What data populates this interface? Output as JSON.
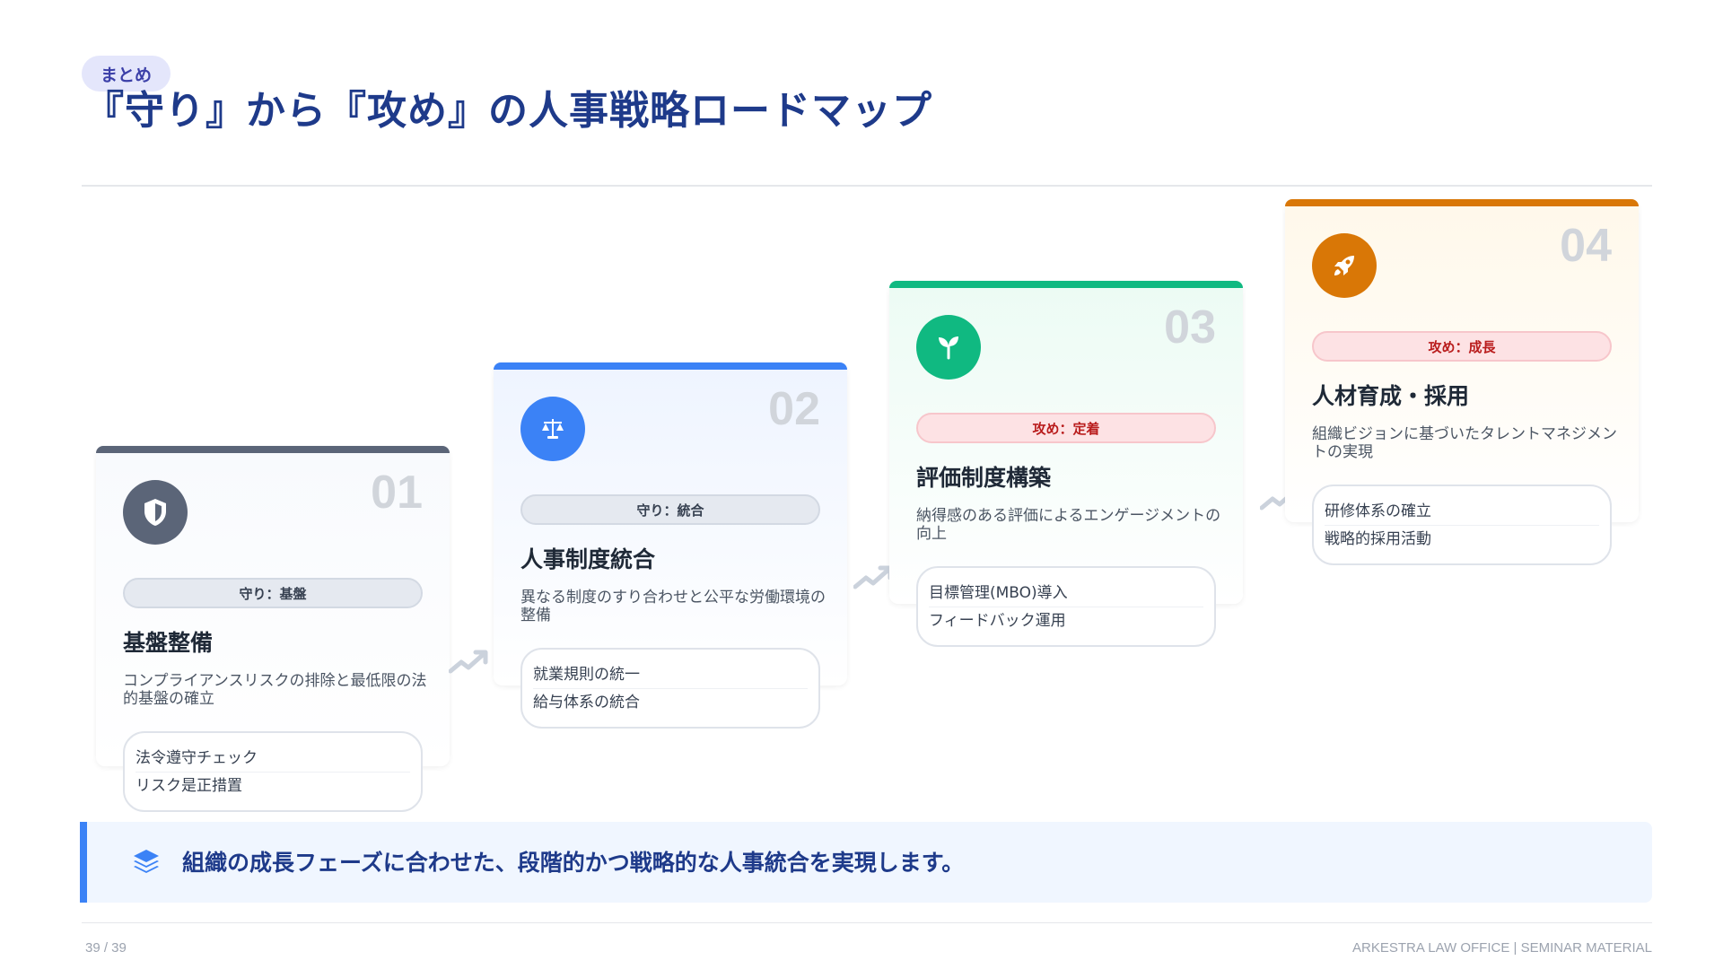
{
  "header": {
    "badge": "まとめ",
    "title": "『守り』から『攻め』の人事戦略ロードマップ"
  },
  "steps": [
    {
      "number": "01",
      "icon": "shield-icon",
      "accent": "#5b6578",
      "tag": "守り：基盤",
      "tag_bg": "#e5e9f0",
      "tag_color": "#374151",
      "title": "基盤整備",
      "desc": "コンプライアンスリスクの排除と最低限の法的基盤の確立",
      "items": [
        "法令遵守チェック",
        "リスク是正措置"
      ]
    },
    {
      "number": "02",
      "icon": "scale-icon",
      "accent": "#3b82f6",
      "tag": "守り：統合",
      "tag_bg": "#e5e9f0",
      "tag_color": "#374151",
      "title": "人事制度統合",
      "desc": "異なる制度のすり合わせと公平な労働環境の整備",
      "items": [
        "就業規則の統一",
        "給与体系の統合"
      ]
    },
    {
      "number": "03",
      "icon": "sprout-icon",
      "accent": "#10b981",
      "tag": "攻め：定着",
      "tag_bg": "#fde2e4",
      "tag_color": "#b91c1c",
      "title": "評価制度構築",
      "desc": "納得感のある評価によるエンゲージメントの向上",
      "items": [
        "目標管理(MBO)導入",
        "フィードバック運用"
      ]
    },
    {
      "number": "04",
      "icon": "rocket-icon",
      "accent": "#d97706",
      "tag": "攻め：成長",
      "tag_bg": "#fde2e4",
      "tag_color": "#b91c1c",
      "title": "人材育成・採用",
      "desc": "組織ビジョンに基づいたタレントマネジメントの実現",
      "items": [
        "研修体系の確立",
        "戦略的採用活動"
      ]
    }
  ],
  "summary": {
    "icon": "layers-icon",
    "text": "組織の成長フェーズに合わせた、段階的かつ戦略的な人事統合を実現します。"
  },
  "footer": {
    "page": "39 / 39",
    "brand": "ARKESTRA LAW OFFICE | SEMINAR MATERIAL"
  }
}
